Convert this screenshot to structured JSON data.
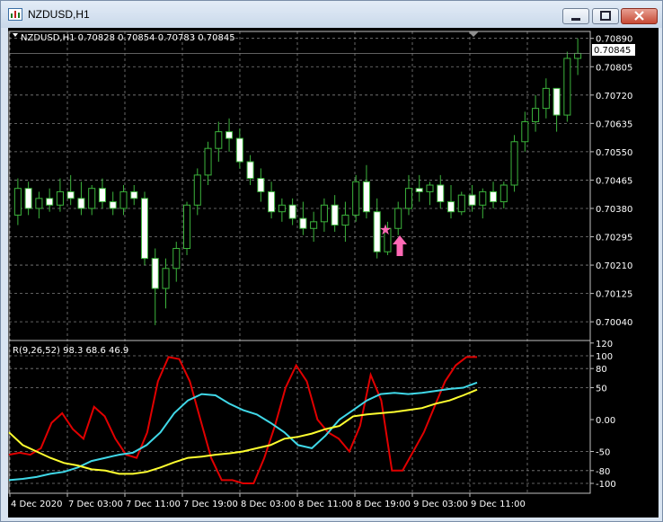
{
  "window": {
    "title": "NZDUSD,H1"
  },
  "main_pane": {
    "header": "NZDUSD,H1  0.70828 0.70854 0.70783 0.70845",
    "price_labels": [
      "0.70890",
      "0.70805",
      "0.70720",
      "0.70635",
      "0.70550",
      "0.70465",
      "0.70380",
      "0.70295",
      "0.70210",
      "0.70125",
      "0.70040"
    ],
    "current_price": "0.70845",
    "star_marker": "★",
    "colors": {
      "bull": "#3cb43c",
      "bear": "#ffffff",
      "grid": "#808080",
      "marker": "#ff69b4"
    }
  },
  "sub_pane": {
    "header": "R(9,26,52) 98.3 68.6 46.9",
    "scale_labels": [
      "120",
      "100",
      "80",
      "50",
      "0.00",
      "-50",
      "-80",
      "-100"
    ],
    "colors": {
      "r9": "#e00000",
      "r26": "#40d8e8",
      "r52": "#ffff30"
    }
  },
  "time_labels": [
    "4 Dec 2020",
    "7 Dec 03:00",
    "7 Dec 11:00",
    "7 Dec 19:00",
    "8 Dec 03:00",
    "8 Dec 11:00",
    "8 Dec 19:00",
    "9 Dec 03:00",
    "9 Dec 11:00"
  ],
  "chart_data": [
    {
      "type": "candlestick",
      "symbol": "NZDUSD",
      "timeframe": "H1",
      "y_range": [
        0.7,
        0.709
      ],
      "ohlc": [
        [
          0.7036,
          0.7047,
          0.7033,
          0.7044
        ],
        [
          0.7044,
          0.7046,
          0.7036,
          0.7038
        ],
        [
          0.7038,
          0.7043,
          0.7035,
          0.7041
        ],
        [
          0.7041,
          0.7044,
          0.7037,
          0.7039
        ],
        [
          0.7039,
          0.7047,
          0.7037,
          0.7043
        ],
        [
          0.7043,
          0.7048,
          0.7039,
          0.7041
        ],
        [
          0.7041,
          0.7046,
          0.7036,
          0.7038
        ],
        [
          0.7038,
          0.7045,
          0.7036,
          0.7044
        ],
        [
          0.7044,
          0.7047,
          0.7038,
          0.704
        ],
        [
          0.704,
          0.7043,
          0.7036,
          0.7038
        ],
        [
          0.7038,
          0.7045,
          0.7036,
          0.7043
        ],
        [
          0.7043,
          0.7045,
          0.7039,
          0.7041
        ],
        [
          0.7041,
          0.7043,
          0.7021,
          0.7023
        ],
        [
          0.7023,
          0.7026,
          0.7003,
          0.7014
        ],
        [
          0.7014,
          0.7023,
          0.7008,
          0.702
        ],
        [
          0.702,
          0.7028,
          0.7016,
          0.7026
        ],
        [
          0.7026,
          0.704,
          0.7024,
          0.7039
        ],
        [
          0.7039,
          0.705,
          0.7036,
          0.7048
        ],
        [
          0.7048,
          0.7058,
          0.7045,
          0.7056
        ],
        [
          0.7056,
          0.7064,
          0.7052,
          0.7061
        ],
        [
          0.7061,
          0.7065,
          0.7055,
          0.7059
        ],
        [
          0.7059,
          0.7062,
          0.705,
          0.7052
        ],
        [
          0.7052,
          0.7054,
          0.7045,
          0.7047
        ],
        [
          0.7047,
          0.705,
          0.704,
          0.7043
        ],
        [
          0.7043,
          0.7046,
          0.7035,
          0.7037
        ],
        [
          0.7037,
          0.7041,
          0.7034,
          0.7039
        ],
        [
          0.7039,
          0.7041,
          0.7033,
          0.7035
        ],
        [
          0.7035,
          0.704,
          0.703,
          0.7032
        ],
        [
          0.7032,
          0.7037,
          0.7028,
          0.7034
        ],
        [
          0.7034,
          0.7041,
          0.7031,
          0.7039
        ],
        [
          0.7039,
          0.7042,
          0.7031,
          0.7033
        ],
        [
          0.7033,
          0.704,
          0.7028,
          0.7036
        ],
        [
          0.7036,
          0.7048,
          0.7034,
          0.7046
        ],
        [
          0.7046,
          0.7051,
          0.7035,
          0.7037
        ],
        [
          0.7037,
          0.7041,
          0.7023,
          0.7025
        ],
        [
          0.7025,
          0.7034,
          0.7024,
          0.7032
        ],
        [
          0.7032,
          0.704,
          0.703,
          0.7038
        ],
        [
          0.7038,
          0.7048,
          0.7036,
          0.7044
        ],
        [
          0.7044,
          0.7048,
          0.704,
          0.7043
        ],
        [
          0.7043,
          0.7046,
          0.7039,
          0.7045
        ],
        [
          0.7045,
          0.7048,
          0.7038,
          0.704
        ],
        [
          0.704,
          0.7045,
          0.7035,
          0.7037
        ],
        [
          0.7037,
          0.7043,
          0.7036,
          0.7042
        ],
        [
          0.7042,
          0.7045,
          0.7037,
          0.7039
        ],
        [
          0.7039,
          0.7044,
          0.7035,
          0.7043
        ],
        [
          0.7043,
          0.7046,
          0.7038,
          0.704
        ],
        [
          0.704,
          0.7046,
          0.7038,
          0.7045
        ],
        [
          0.7045,
          0.706,
          0.7043,
          0.7058
        ],
        [
          0.7058,
          0.7067,
          0.7055,
          0.7064
        ],
        [
          0.7064,
          0.7072,
          0.7061,
          0.7068
        ],
        [
          0.7068,
          0.7077,
          0.7065,
          0.7074
        ],
        [
          0.7074,
          0.7073,
          0.7061,
          0.7066
        ],
        [
          0.7066,
          0.7085,
          0.7064,
          0.7083
        ],
        [
          0.7083,
          0.7089,
          0.7078,
          0.70845
        ]
      ]
    },
    {
      "type": "line",
      "title": "R(9,26,52)",
      "ylim": [
        -100,
        100
      ],
      "series": [
        {
          "name": "R(9)",
          "values": [
            -55,
            -52,
            -55,
            -45,
            -5,
            10,
            -15,
            -30,
            20,
            5,
            -30,
            -55,
            -60,
            -20,
            60,
            98,
            95,
            60,
            0,
            -60,
            -95,
            -95,
            -100,
            -100,
            -60,
            -10,
            50,
            85,
            60,
            0,
            -20,
            -30,
            -50,
            -10,
            70,
            30,
            -80,
            -80,
            -50,
            -20,
            20,
            60,
            85,
            98,
            98
          ]
        },
        {
          "name": "R(26)",
          "values": [
            -95,
            -93,
            -90,
            -85,
            -82,
            -75,
            -65,
            -60,
            -55,
            -52,
            -40,
            -20,
            10,
            30,
            40,
            38,
            25,
            15,
            8,
            -5,
            -20,
            -40,
            -45,
            -25,
            0,
            15,
            30,
            40,
            42,
            40,
            42,
            45,
            48,
            50,
            58
          ]
        },
        {
          "name": "R(52)",
          "values": [
            -20,
            -40,
            -50,
            -60,
            -68,
            -72,
            -78,
            -80,
            -85,
            -85,
            -82,
            -75,
            -67,
            -60,
            -58,
            -55,
            -53,
            -50,
            -45,
            -40,
            -30,
            -27,
            -22,
            -15,
            -10,
            5,
            8,
            10,
            12,
            15,
            18,
            25,
            30,
            38,
            46.9
          ]
        }
      ]
    }
  ]
}
